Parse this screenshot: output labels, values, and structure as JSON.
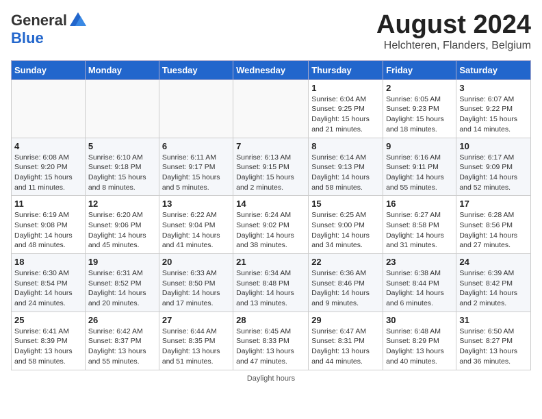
{
  "header": {
    "logo_general": "General",
    "logo_blue": "Blue",
    "month_year": "August 2024",
    "location": "Helchteren, Flanders, Belgium"
  },
  "days_of_week": [
    "Sunday",
    "Monday",
    "Tuesday",
    "Wednesday",
    "Thursday",
    "Friday",
    "Saturday"
  ],
  "weeks": [
    [
      {
        "day": "",
        "info": ""
      },
      {
        "day": "",
        "info": ""
      },
      {
        "day": "",
        "info": ""
      },
      {
        "day": "",
        "info": ""
      },
      {
        "day": "1",
        "info": "Sunrise: 6:04 AM\nSunset: 9:25 PM\nDaylight: 15 hours and 21 minutes."
      },
      {
        "day": "2",
        "info": "Sunrise: 6:05 AM\nSunset: 9:23 PM\nDaylight: 15 hours and 18 minutes."
      },
      {
        "day": "3",
        "info": "Sunrise: 6:07 AM\nSunset: 9:22 PM\nDaylight: 15 hours and 14 minutes."
      }
    ],
    [
      {
        "day": "4",
        "info": "Sunrise: 6:08 AM\nSunset: 9:20 PM\nDaylight: 15 hours and 11 minutes."
      },
      {
        "day": "5",
        "info": "Sunrise: 6:10 AM\nSunset: 9:18 PM\nDaylight: 15 hours and 8 minutes."
      },
      {
        "day": "6",
        "info": "Sunrise: 6:11 AM\nSunset: 9:17 PM\nDaylight: 15 hours and 5 minutes."
      },
      {
        "day": "7",
        "info": "Sunrise: 6:13 AM\nSunset: 9:15 PM\nDaylight: 15 hours and 2 minutes."
      },
      {
        "day": "8",
        "info": "Sunrise: 6:14 AM\nSunset: 9:13 PM\nDaylight: 14 hours and 58 minutes."
      },
      {
        "day": "9",
        "info": "Sunrise: 6:16 AM\nSunset: 9:11 PM\nDaylight: 14 hours and 55 minutes."
      },
      {
        "day": "10",
        "info": "Sunrise: 6:17 AM\nSunset: 9:09 PM\nDaylight: 14 hours and 52 minutes."
      }
    ],
    [
      {
        "day": "11",
        "info": "Sunrise: 6:19 AM\nSunset: 9:08 PM\nDaylight: 14 hours and 48 minutes."
      },
      {
        "day": "12",
        "info": "Sunrise: 6:20 AM\nSunset: 9:06 PM\nDaylight: 14 hours and 45 minutes."
      },
      {
        "day": "13",
        "info": "Sunrise: 6:22 AM\nSunset: 9:04 PM\nDaylight: 14 hours and 41 minutes."
      },
      {
        "day": "14",
        "info": "Sunrise: 6:24 AM\nSunset: 9:02 PM\nDaylight: 14 hours and 38 minutes."
      },
      {
        "day": "15",
        "info": "Sunrise: 6:25 AM\nSunset: 9:00 PM\nDaylight: 14 hours and 34 minutes."
      },
      {
        "day": "16",
        "info": "Sunrise: 6:27 AM\nSunset: 8:58 PM\nDaylight: 14 hours and 31 minutes."
      },
      {
        "day": "17",
        "info": "Sunrise: 6:28 AM\nSunset: 8:56 PM\nDaylight: 14 hours and 27 minutes."
      }
    ],
    [
      {
        "day": "18",
        "info": "Sunrise: 6:30 AM\nSunset: 8:54 PM\nDaylight: 14 hours and 24 minutes."
      },
      {
        "day": "19",
        "info": "Sunrise: 6:31 AM\nSunset: 8:52 PM\nDaylight: 14 hours and 20 minutes."
      },
      {
        "day": "20",
        "info": "Sunrise: 6:33 AM\nSunset: 8:50 PM\nDaylight: 14 hours and 17 minutes."
      },
      {
        "day": "21",
        "info": "Sunrise: 6:34 AM\nSunset: 8:48 PM\nDaylight: 14 hours and 13 minutes."
      },
      {
        "day": "22",
        "info": "Sunrise: 6:36 AM\nSunset: 8:46 PM\nDaylight: 14 hours and 9 minutes."
      },
      {
        "day": "23",
        "info": "Sunrise: 6:38 AM\nSunset: 8:44 PM\nDaylight: 14 hours and 6 minutes."
      },
      {
        "day": "24",
        "info": "Sunrise: 6:39 AM\nSunset: 8:42 PM\nDaylight: 14 hours and 2 minutes."
      }
    ],
    [
      {
        "day": "25",
        "info": "Sunrise: 6:41 AM\nSunset: 8:39 PM\nDaylight: 13 hours and 58 minutes."
      },
      {
        "day": "26",
        "info": "Sunrise: 6:42 AM\nSunset: 8:37 PM\nDaylight: 13 hours and 55 minutes."
      },
      {
        "day": "27",
        "info": "Sunrise: 6:44 AM\nSunset: 8:35 PM\nDaylight: 13 hours and 51 minutes."
      },
      {
        "day": "28",
        "info": "Sunrise: 6:45 AM\nSunset: 8:33 PM\nDaylight: 13 hours and 47 minutes."
      },
      {
        "day": "29",
        "info": "Sunrise: 6:47 AM\nSunset: 8:31 PM\nDaylight: 13 hours and 44 minutes."
      },
      {
        "day": "30",
        "info": "Sunrise: 6:48 AM\nSunset: 8:29 PM\nDaylight: 13 hours and 40 minutes."
      },
      {
        "day": "31",
        "info": "Sunrise: 6:50 AM\nSunset: 8:27 PM\nDaylight: 13 hours and 36 minutes."
      }
    ]
  ],
  "footer": {
    "daylight_note": "Daylight hours"
  }
}
